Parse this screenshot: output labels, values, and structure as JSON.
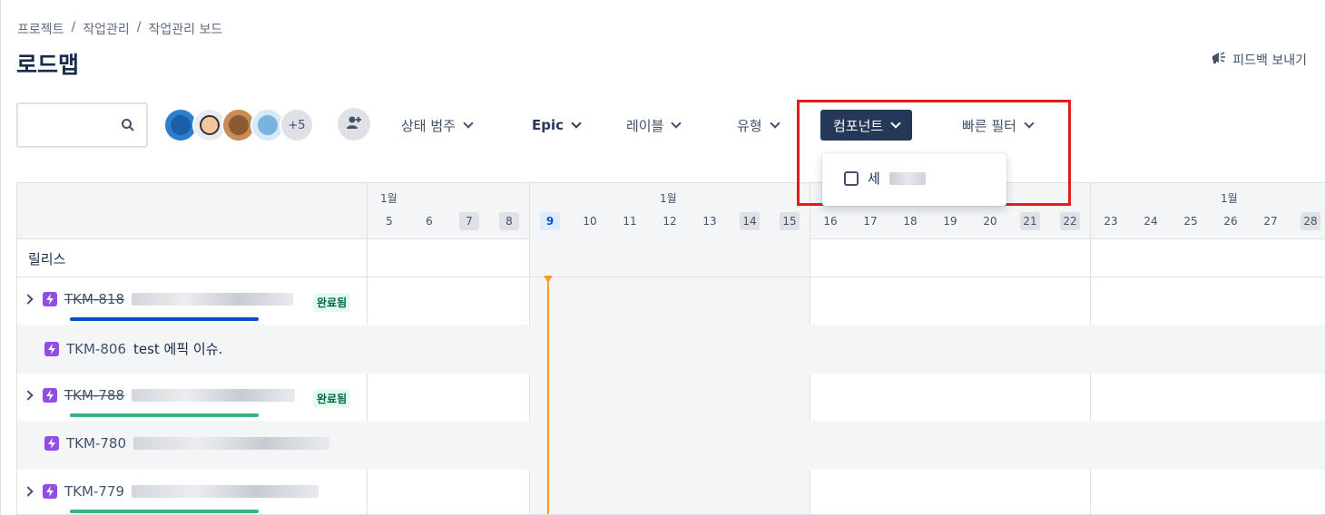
{
  "breadcrumb": [
    "프로젝트",
    "작업관리",
    "작업관리 보드"
  ],
  "breadcrumb_sep": "/",
  "page_title": "로드맵",
  "feedback_label": "피드백 보내기",
  "search": {
    "placeholder": ""
  },
  "avatars_more": "+5",
  "filters": {
    "status": "상태 범주",
    "epic": "Epic",
    "label": "레이블",
    "type": "유형",
    "component": "컴포넌트",
    "quick": "빠른 필터"
  },
  "dropdown": {
    "option_prefix": "세"
  },
  "timeline": {
    "months": [
      "1월",
      "1월",
      "1월"
    ],
    "week1_days": [
      "5",
      "6",
      "7",
      "8"
    ],
    "week2_days": [
      "9",
      "10",
      "11",
      "12",
      "13",
      "14",
      "15"
    ],
    "week3_days": [
      "16",
      "17",
      "18",
      "19",
      "20",
      "21",
      "22"
    ],
    "week4_days": [
      "23",
      "24",
      "25",
      "26",
      "27",
      "28"
    ],
    "release_label": "릴리스"
  },
  "issues": [
    {
      "key": "TKM-818",
      "badge": "완료됨",
      "bar_color": "#0052cc"
    },
    {
      "key": "TKM-806",
      "summary": "test 에픽 이슈."
    },
    {
      "key": "TKM-788",
      "badge": "완료됨",
      "bar_color": "#36b37e"
    },
    {
      "key": "TKM-780"
    },
    {
      "key": "TKM-779",
      "bar_color": "#36b37e"
    }
  ],
  "colors": {
    "accent": "#253858",
    "highlight": "#e01e1e",
    "today": "#ff991f",
    "epic": "#904ee2"
  }
}
